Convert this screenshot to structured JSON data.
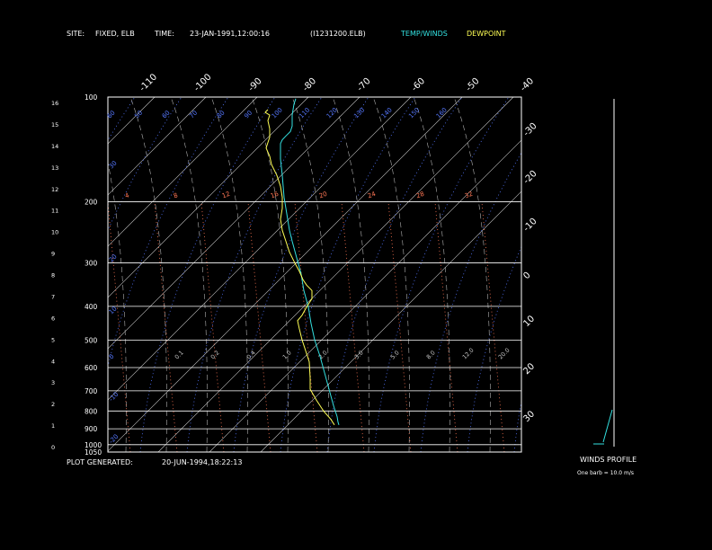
{
  "header": {
    "site_label": "SITE:",
    "site_value": "FIXED, ELB",
    "time_label": "TIME:",
    "time_value": "23-JAN-1991,12:00:16",
    "file_id": "(I1231200.ELB)",
    "legend_temp": "TEMP/WINDS",
    "legend_dew": "DEWPOINT"
  },
  "footer": {
    "generated_label": "PLOT GENERATED:",
    "generated_value": "20-JUN-1994,18:22:13"
  },
  "winds": {
    "title": "WINDS PROFILE",
    "note": "One barb = 10.0 m/s"
  },
  "colors": {
    "temp": "#33e0e0",
    "dew": "#ffff55",
    "isotherm": "#c8c8c8",
    "dry_adiabat": "#5577ff",
    "mixing_ratio": "#ff7755",
    "moist_adiabat": "#b0b0b0",
    "text": "#ffffff"
  },
  "chart_data": {
    "type": "line",
    "y_scale": "log-pressure",
    "pressure_range_mb": [
      1050,
      100
    ],
    "pressure_levels_mb": [
      "100",
      "200",
      "300",
      "400",
      "500",
      "600",
      "700",
      "800",
      "900",
      "1000",
      "1050"
    ],
    "height_ticks_km": [
      "0",
      "1",
      "2",
      "3",
      "4",
      "5",
      "6",
      "7",
      "8",
      "9",
      "10",
      "11",
      "12",
      "13",
      "14",
      "15",
      "16"
    ],
    "isotherm_labels_top": [
      "-110",
      "-100",
      "-90",
      "-80",
      "-70",
      "-60",
      "-50",
      "-40"
    ],
    "isotherm_labels_right": [
      "-30",
      "-20",
      "-10",
      "0",
      "10",
      "20",
      "30"
    ],
    "mixing_ratio_labels": [
      "4",
      "8",
      "12",
      "16",
      "20",
      "24",
      "28",
      "32"
    ],
    "dry_adiabat_labels": [
      "60",
      "50",
      "60",
      "70",
      "80",
      "90",
      "100",
      "110",
      "120",
      "130",
      "140",
      "150",
      "160"
    ],
    "dry_adiabat_left_labels": [
      "30",
      "20",
      "10",
      "0",
      "-10",
      "-20"
    ],
    "mixing_ratio_lower_labels": [
      "0.1",
      "0.2",
      "0.4",
      "1.0",
      "2.0",
      "3.0",
      "5.0",
      "8.0",
      "12.0",
      "20.0"
    ],
    "series": [
      {
        "name": "TEMP/WINDS",
        "points": [
          [
            -61,
            180
          ],
          [
            -63,
            190
          ],
          [
            -64,
            200
          ],
          [
            -65,
            210
          ],
          [
            -65,
            220
          ],
          [
            -65,
            230
          ],
          [
            -67,
            240
          ],
          [
            -72,
            248
          ],
          [
            -76,
            255
          ],
          [
            -78,
            262
          ],
          [
            -78,
            275
          ],
          [
            -78,
            290
          ],
          [
            -77,
            305
          ],
          [
            -76,
            320
          ],
          [
            -75,
            340
          ],
          [
            -74,
            360
          ],
          [
            -72,
            380
          ],
          [
            -70,
            400
          ],
          [
            -68,
            420
          ],
          [
            -65,
            440
          ],
          [
            -60,
            470
          ],
          [
            -55,
            500
          ],
          [
            -52,
            530
          ],
          [
            -47,
            560
          ],
          [
            -44,
            590
          ],
          [
            -40,
            620
          ],
          [
            -34,
            650
          ],
          [
            -29,
            680
          ],
          [
            -24,
            710
          ],
          [
            -19,
            740
          ],
          [
            -15,
            760
          ],
          [
            -14,
            770
          ],
          [
            -13,
            775
          ]
        ]
      },
      {
        "name": "DEWPOINT",
        "points": [
          [
            -92,
            200
          ],
          [
            -95,
            205
          ],
          [
            -90,
            210
          ],
          [
            -92,
            220
          ],
          [
            -90,
            235
          ],
          [
            -90,
            250
          ],
          [
            -92,
            260
          ],
          [
            -94,
            270
          ],
          [
            -90,
            285
          ],
          [
            -88,
            300
          ],
          [
            -82,
            320
          ],
          [
            -78,
            340
          ],
          [
            -76,
            360
          ],
          [
            -76,
            380
          ],
          [
            -78,
            400
          ],
          [
            -76,
            420
          ],
          [
            -72,
            440
          ],
          [
            -68,
            460
          ],
          [
            -62,
            480
          ],
          [
            -57,
            495
          ],
          [
            -53,
            510
          ],
          [
            -49,
            520
          ],
          [
            -43,
            530
          ],
          [
            -43,
            545
          ],
          [
            -49,
            560
          ],
          [
            -54,
            575
          ],
          [
            -59,
            585
          ],
          [
            -57,
            600
          ],
          [
            -54,
            620
          ],
          [
            -50,
            640
          ],
          [
            -46,
            660
          ],
          [
            -45,
            690
          ],
          [
            -45,
            710
          ],
          [
            -38,
            730
          ],
          [
            -30,
            750
          ],
          [
            -22,
            765
          ],
          [
            -18,
            775
          ]
        ]
      }
    ],
    "wind_profile": [
      [
        671,
        492
      ],
      [
        681,
        456
      ]
    ]
  }
}
